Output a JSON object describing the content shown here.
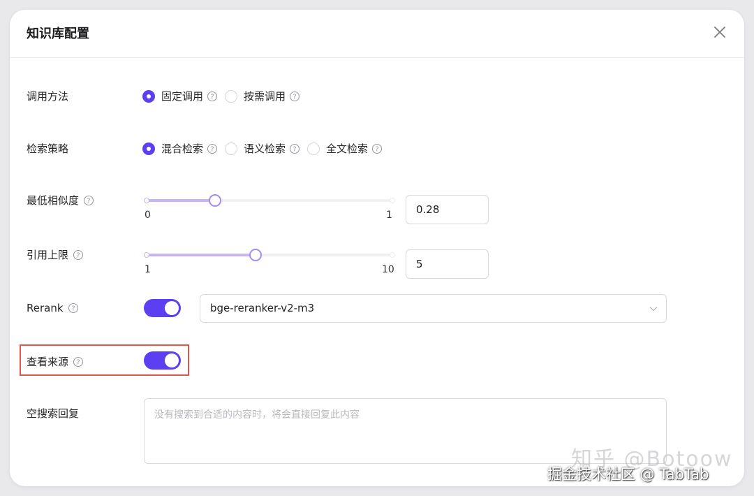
{
  "dialog": {
    "title": "知识库配置",
    "close_icon": "close-icon"
  },
  "call_method": {
    "label": "调用方法",
    "options": [
      {
        "label": "固定调用",
        "selected": true
      },
      {
        "label": "按需调用",
        "selected": false
      }
    ]
  },
  "search_strategy": {
    "label": "检索策略",
    "options": [
      {
        "label": "混合检索",
        "selected": true
      },
      {
        "label": "语义检索",
        "selected": false
      },
      {
        "label": "全文检索",
        "selected": false
      }
    ]
  },
  "min_similarity": {
    "label": "最低相似度",
    "min_label": "0",
    "max_label": "1",
    "value": "0.28",
    "fraction": 0.28
  },
  "citation_limit": {
    "label": "引用上限",
    "min_label": "1",
    "max_label": "10",
    "value": "5",
    "fraction": 0.444
  },
  "rerank": {
    "label": "Rerank",
    "enabled": true,
    "model": "bge-reranker-v2-m3",
    "dropdown_icon": "chevron-down-icon"
  },
  "show_source": {
    "label": "查看来源",
    "enabled": true
  },
  "empty_search_reply": {
    "label": "空搜索回复",
    "placeholder": "没有搜索到合适的内容时，将会直接回复此内容"
  },
  "watermark": {
    "faint": "知乎 @Botoow",
    "text": "掘金技术社区 @ TabTab"
  },
  "colors": {
    "accent": "#5b3ff0",
    "slider_track": "#c6b5f8",
    "highlight": "#e2554b"
  }
}
